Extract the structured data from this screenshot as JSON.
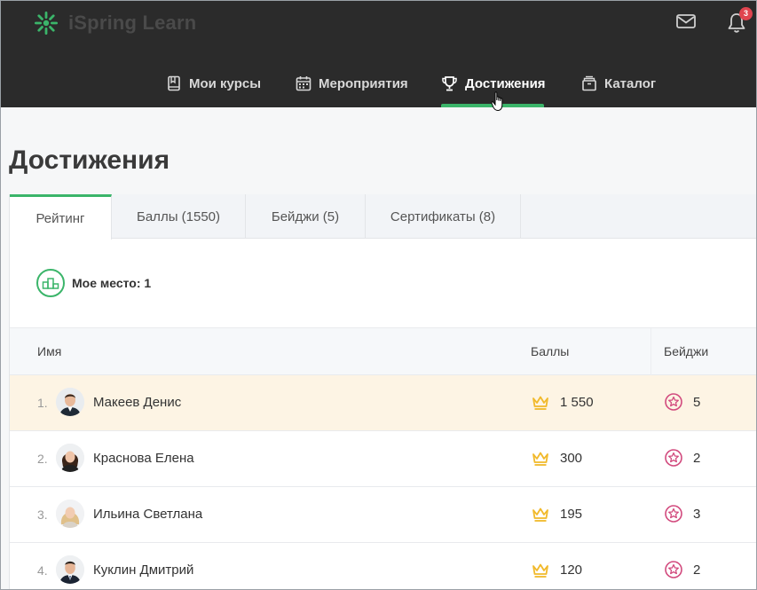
{
  "app": {
    "logo_text": "iSpring Learn",
    "notifications_count": "3"
  },
  "nav": {
    "items": [
      {
        "label": "Мои курсы",
        "icon": "book-icon"
      },
      {
        "label": "Мероприятия",
        "icon": "calendar-icon"
      },
      {
        "label": "Достижения",
        "icon": "trophy-icon",
        "active": true
      },
      {
        "label": "Каталог",
        "icon": "catalog-box-icon"
      }
    ]
  },
  "page": {
    "title": "Достижения"
  },
  "tabs": [
    {
      "label": "Рейтинг",
      "active": true
    },
    {
      "label": "Баллы (1550)"
    },
    {
      "label": "Бейджи (5)"
    },
    {
      "label": "Сертификаты (8)"
    }
  ],
  "my_place": {
    "label": "Мое место: 1"
  },
  "table": {
    "headers": {
      "name": "Имя",
      "points": "Баллы",
      "badges": "Бейджи"
    },
    "rows": [
      {
        "rank": "1.",
        "name": "Макеев Денис",
        "points": "1 550",
        "badges": "5"
      },
      {
        "rank": "2.",
        "name": "Краснова Елена",
        "points": "300",
        "badges": "2"
      },
      {
        "rank": "3.",
        "name": "Ильина Светлана",
        "points": "195",
        "badges": "3"
      },
      {
        "rank": "4.",
        "name": "Куклин Дмитрий",
        "points": "120",
        "badges": "2"
      }
    ]
  },
  "colors": {
    "accent": "#3bb56a",
    "header_bg": "#2b2b2b",
    "highlight_row": "#fdf4e4",
    "crown": "#f1b92a",
    "badge": "#d24b7e",
    "notification": "#e0444f"
  }
}
